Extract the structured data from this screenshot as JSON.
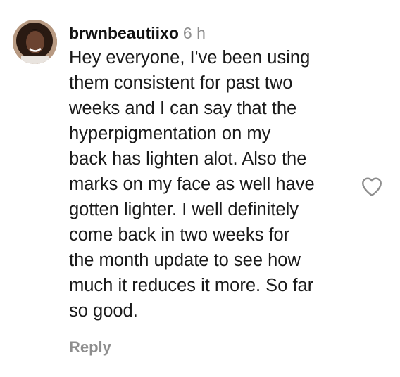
{
  "comment": {
    "username": "brwnbeautiixo",
    "timestamp": "6 h",
    "lines": [
      "Hey everyone, I've been using",
      "them consistent for past two",
      "weeks and I can say that the",
      "hyperpigmentation on my",
      "back has lighten alot. Also the",
      "marks on my face as well have",
      "gotten lighter. I well definitely",
      "come back in two weeks for",
      "the month update to see how",
      "much it reduces it more. So far",
      "so good."
    ],
    "reply_label": "Reply",
    "like_icon": "heart-outline-icon"
  },
  "colors": {
    "text": "#1a1a1a",
    "muted": "#8e8e8e",
    "background": "#ffffff"
  }
}
